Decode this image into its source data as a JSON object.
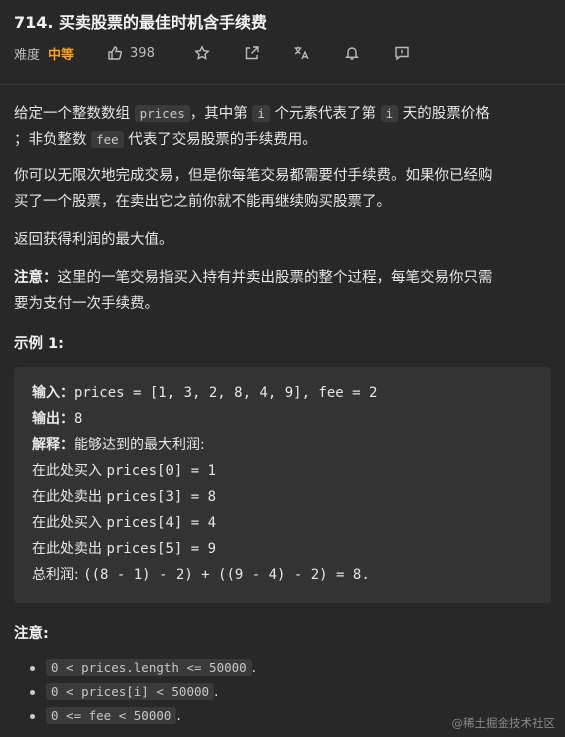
{
  "header": {
    "title": "714. 买卖股票的最佳时机含手续费",
    "difficulty_label": "难度",
    "difficulty_value": "中等",
    "likes": "398",
    "colors": {
      "difficulty": "#ffa116"
    }
  },
  "description": {
    "p1_a": "给定一个整数数组 ",
    "p1_code1": "prices",
    "p1_b": "，其中第 ",
    "p1_code2": "i",
    "p1_c": " 个元素代表了第 ",
    "p1_code3": "i",
    "p1_d": " 天的股票价格",
    "p1_e": "；非负整数 ",
    "p1_code4": "fee",
    "p1_f": " 代表了交易股票的手续费用。",
    "p2_line1": "你可以无限次地完成交易，但是你每笔交易都需要付手续费。如果你已经购",
    "p2_line2": "买了一个股票，在卖出它之前你就不能再继续购买股票了。",
    "p3": "返回获得利润的最大值。",
    "note_label": "注意：",
    "note_line1": "这里的一笔交易指买入持有并卖出股票的整个过程，每笔交易你只需",
    "note_line2": "要为支付一次手续费。"
  },
  "example": {
    "heading": "示例 1:",
    "input_label": "输入：",
    "input_value": "prices = [1, 3, 2, 8, 4, 9], fee = 2",
    "output_label": "输出：",
    "output_value": "8",
    "explain_label": "解释：",
    "explain_value": "能够达到的最大利润:",
    "steps": [
      {
        "cn": "在此处买入 ",
        "code": "prices[0] = 1"
      },
      {
        "cn": "在此处卖出 ",
        "code": "prices[3] = 8"
      },
      {
        "cn": "在此处买入 ",
        "code": "prices[4] = 4"
      },
      {
        "cn": "在此处卖出 ",
        "code": "prices[5] = 9"
      }
    ],
    "total_cn": "总利润: ",
    "total_code": "((8 - 1) - 2) + ((9 - 4) - 2) = 8."
  },
  "constraints": {
    "heading": "注意:",
    "items": [
      "0 < prices.length <= 50000",
      "0 < prices[i] < 50000",
      "0 <= fee < 50000"
    ]
  },
  "watermark": "@稀土掘金技术社区",
  "icons": [
    "thumbs-up-icon",
    "star-icon",
    "share-icon",
    "translate-icon",
    "bell-icon",
    "feedback-icon"
  ]
}
